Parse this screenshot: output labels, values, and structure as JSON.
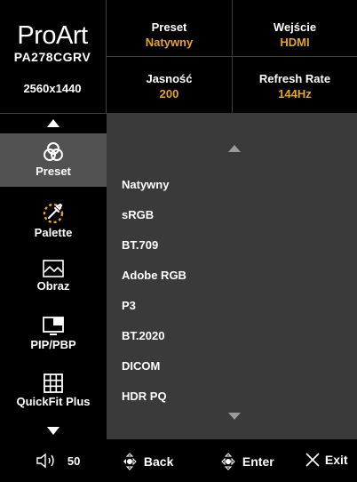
{
  "header": {
    "brand": "ProArt",
    "model": "PA278CGRV",
    "resolution": "2560x1440",
    "cells": [
      {
        "label": "Preset",
        "value": "Natywny"
      },
      {
        "label": "Wejście",
        "value": "HDMI"
      },
      {
        "label": "Jasność",
        "value": "200"
      },
      {
        "label": "Refresh Rate",
        "value": "144Hz"
      }
    ]
  },
  "sidebar": {
    "items": [
      {
        "label": "Preset",
        "icon": "preset-rings-icon",
        "selected": true
      },
      {
        "label": "Palette",
        "icon": "palette-eyedropper-icon",
        "selected": false
      },
      {
        "label": "Obraz",
        "icon": "image-icon",
        "selected": false
      },
      {
        "label": "PIP/PBP",
        "icon": "pip-pbp-icon",
        "selected": false
      },
      {
        "label": "QuickFit Plus",
        "icon": "grid-icon",
        "selected": false
      }
    ]
  },
  "list": {
    "options": [
      "Natywny",
      "sRGB",
      "BT.709",
      "Adobe RGB",
      "P3",
      "BT.2020",
      "DICOM",
      "HDR PQ"
    ]
  },
  "footer": {
    "volume": "50",
    "back": "Back",
    "enter": "Enter",
    "exit": "Exit"
  },
  "colors": {
    "accent": "#e6a623",
    "selected_bg": "#525252",
    "panel_bg": "#3a3a3a"
  }
}
